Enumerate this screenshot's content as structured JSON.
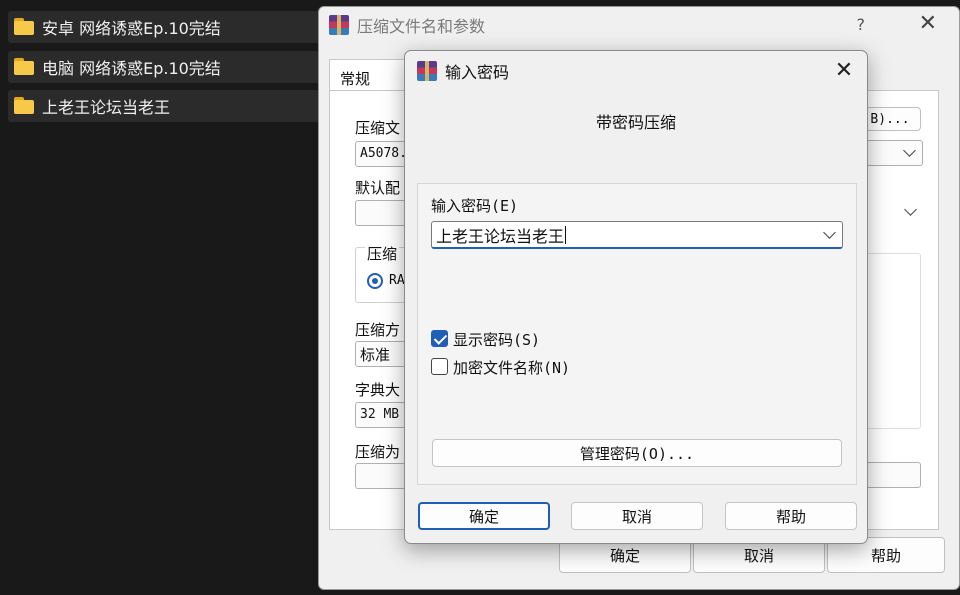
{
  "explorer": {
    "folders": [
      {
        "label": "安卓 网络诱惑Ep.10完结"
      },
      {
        "label": "电脑 网络诱惑Ep.10完结"
      },
      {
        "label": "上老王论坛当老王"
      }
    ]
  },
  "background_dialog": {
    "title": "压缩文件名和参数",
    "help_glyph": "?",
    "close_glyph": "✕",
    "tab_label": "常规",
    "archive_name_label": "压缩文",
    "archive_name_value": "A5078.",
    "default_profile_label": "默认配",
    "format_group_label": "压缩",
    "format_radio_label": "RA",
    "method_label": "压缩方",
    "method_value": "标准",
    "dict_label": "字典大",
    "dict_value": "32 MB",
    "split_label": "压缩为",
    "browse_label": "B)...",
    "ok_label": "确定",
    "cancel_label": "取消",
    "help_label": "帮助"
  },
  "password_dialog": {
    "title": "输入密码",
    "close_glyph": "✕",
    "heading": "带密码压缩",
    "password_label": "输入密码(E)",
    "password_value": "上老王论坛当老王",
    "show_password_label": "显示密码(S)",
    "show_password_checked": true,
    "encrypt_names_label": "加密文件名称(N)",
    "encrypt_names_checked": false,
    "manage_button": "管理密码(O)...",
    "ok_button": "确定",
    "cancel_button": "取消",
    "help_button": "帮助"
  },
  "colors": {
    "accent": "#1f5fb5",
    "folder": "#f7c948",
    "explorer_bg": "#191919"
  }
}
